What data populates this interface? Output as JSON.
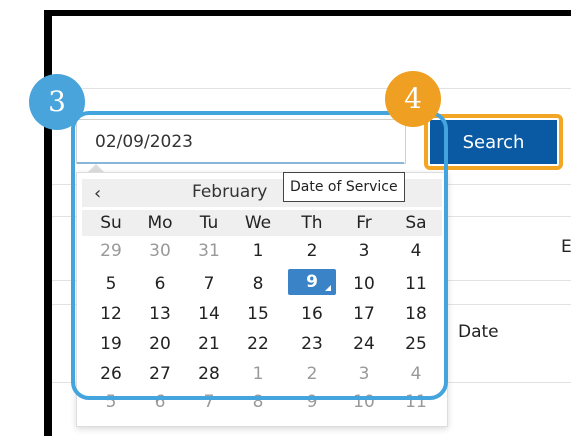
{
  "date_field": {
    "value": "02/09/2023"
  },
  "search_button": {
    "label": "Search"
  },
  "tooltip": {
    "text": "Date of Service"
  },
  "calendar": {
    "prev": "‹",
    "month_label": "February",
    "weekdays": [
      "Su",
      "Mo",
      "Tu",
      "We",
      "Th",
      "Fr",
      "Sa"
    ],
    "weeks": [
      [
        "29",
        "30",
        "31",
        "1",
        "2",
        "3",
        "4"
      ],
      [
        "5",
        "6",
        "7",
        "8",
        "9",
        "10",
        "11"
      ],
      [
        "12",
        "13",
        "14",
        "15",
        "16",
        "17",
        "18"
      ],
      [
        "19",
        "20",
        "21",
        "22",
        "23",
        "24",
        "25"
      ],
      [
        "26",
        "27",
        "28",
        "1",
        "2",
        "3",
        "4"
      ],
      [
        "5",
        "6",
        "7",
        "8",
        "9",
        "10",
        "11"
      ]
    ],
    "selected_day": "9"
  },
  "background": {
    "column_header_fragment": "E",
    "row_label": "Date"
  },
  "callouts": {
    "step3": "3",
    "step4": "4"
  },
  "colors": {
    "callout_blue": "#44a4dd",
    "callout_orange": "#f2a623",
    "search_blue": "#0a5aa3",
    "selected_day": "#3a83c6"
  }
}
